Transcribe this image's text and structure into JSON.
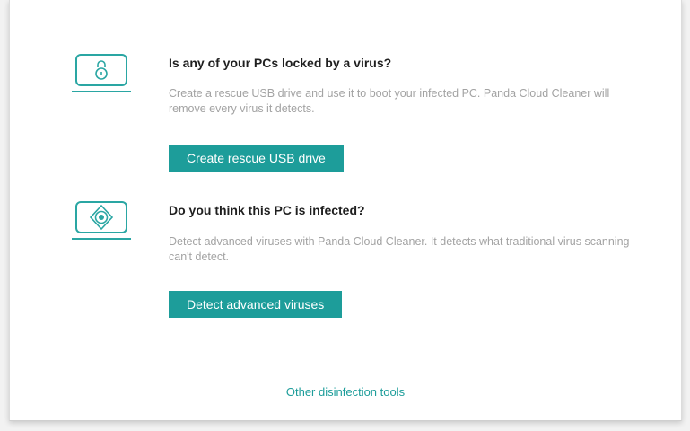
{
  "colors": {
    "accent": "#1d9d9a",
    "icon_stroke": "#2aa6a3",
    "title_text": "#1f1f1f",
    "desc_text": "#a3a3a3"
  },
  "sections": [
    {
      "icon": "lock-icon",
      "title": "Is any of your PCs locked by a virus?",
      "description": "Create a rescue USB drive and use it to boot your infected PC.  Panda Cloud Cleaner will remove every virus it detects.",
      "button_label": "Create rescue USB drive"
    },
    {
      "icon": "target-icon",
      "title": "Do you think this PC is infected?",
      "description": "Detect advanced viruses with Panda Cloud Cleaner. It detects what traditional virus scanning can't detect.",
      "button_label": "Detect advanced viruses"
    }
  ],
  "footer": {
    "link_label": "Other disinfection tools"
  }
}
